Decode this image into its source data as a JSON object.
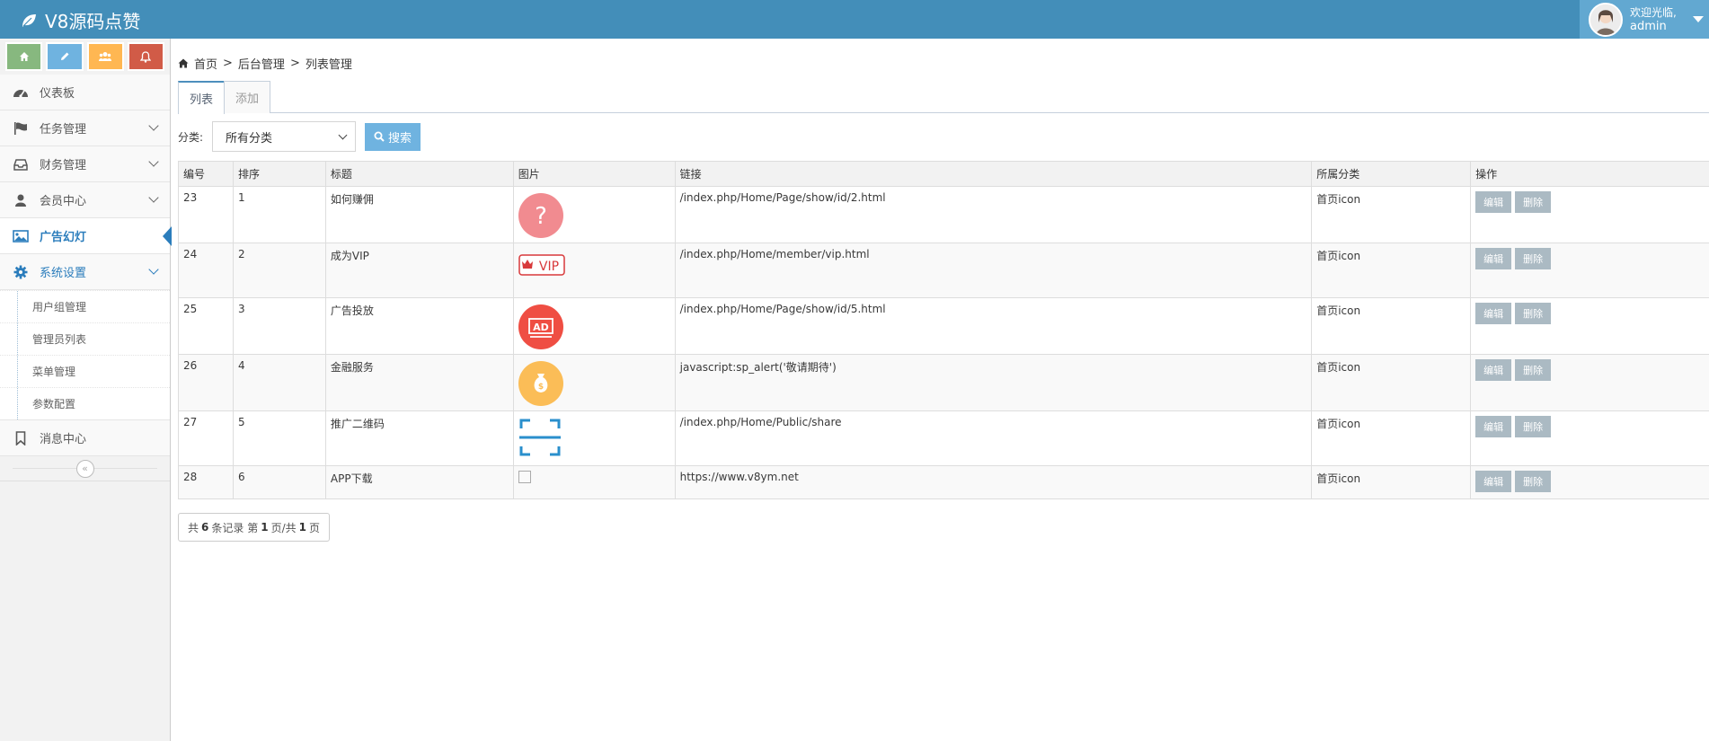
{
  "app": {
    "brand": "V8源码点赞"
  },
  "user": {
    "greeting": "欢迎光临,",
    "name": "admin"
  },
  "sidebar": {
    "items": [
      {
        "label": "仪表板",
        "icon": "dashboard-icon"
      },
      {
        "label": "任务管理",
        "icon": "flag-icon"
      },
      {
        "label": "财务管理",
        "icon": "inbox-icon"
      },
      {
        "label": "会员中心",
        "icon": "user-icon"
      },
      {
        "label": "广告幻灯",
        "icon": "picture-icon"
      },
      {
        "label": "系统设置",
        "icon": "cog-icon"
      },
      {
        "label": "消息中心",
        "icon": "bookmark-icon"
      }
    ],
    "submenu": [
      "用户组管理",
      "管理员列表",
      "菜单管理",
      "参数配置"
    ]
  },
  "breadcrumb": {
    "home": "首页",
    "level2": "后台管理",
    "current": "列表管理",
    "sep": ">"
  },
  "tabs": {
    "list": "列表",
    "add": "添加"
  },
  "filter": {
    "label": "分类:",
    "selected": "所有分类",
    "search_label": "搜索"
  },
  "table": {
    "headers": [
      "编号",
      "排序",
      "标题",
      "图片",
      "链接",
      "所属分类",
      "操作"
    ],
    "rows": [
      {
        "id": "23",
        "sort": "1",
        "title": "如何赚佣",
        "image": "question-icon",
        "link": "/index.php/Home/Page/show/id/2.html",
        "category": "首页icon"
      },
      {
        "id": "24",
        "sort": "2",
        "title": "成为VIP",
        "image": "vip-icon",
        "link": "/index.php/Home/member/vip.html",
        "category": "首页icon"
      },
      {
        "id": "25",
        "sort": "3",
        "title": "广告投放",
        "image": "ad-icon",
        "link": "/index.php/Home/Page/show/id/5.html",
        "category": "首页icon"
      },
      {
        "id": "26",
        "sort": "4",
        "title": "金融服务",
        "image": "money-bag-icon",
        "link": "javascript:sp_alert('敬请期待')",
        "category": "首页icon"
      },
      {
        "id": "27",
        "sort": "5",
        "title": "推广二维码",
        "image": "scan-icon",
        "link": "/index.php/Home/Public/share",
        "category": "首页icon"
      },
      {
        "id": "28",
        "sort": "6",
        "title": "APP下载",
        "image": "broken-image-icon",
        "link": "https://www.v8ym.net",
        "category": "首页icon"
      }
    ],
    "edit_label": "编辑",
    "delete_label": "删除"
  },
  "pager": {
    "prefix": "共",
    "total": "6",
    "records": "条记录 第",
    "page": "1",
    "mid": "页/共",
    "pages": "1",
    "suffix": "页"
  },
  "colors": {
    "navbar": "#438eb9",
    "user_box": "#62a8d1",
    "accent": "#2b7dbc",
    "search_btn": "#6fb3e0",
    "op_btn": "#abbac3"
  }
}
